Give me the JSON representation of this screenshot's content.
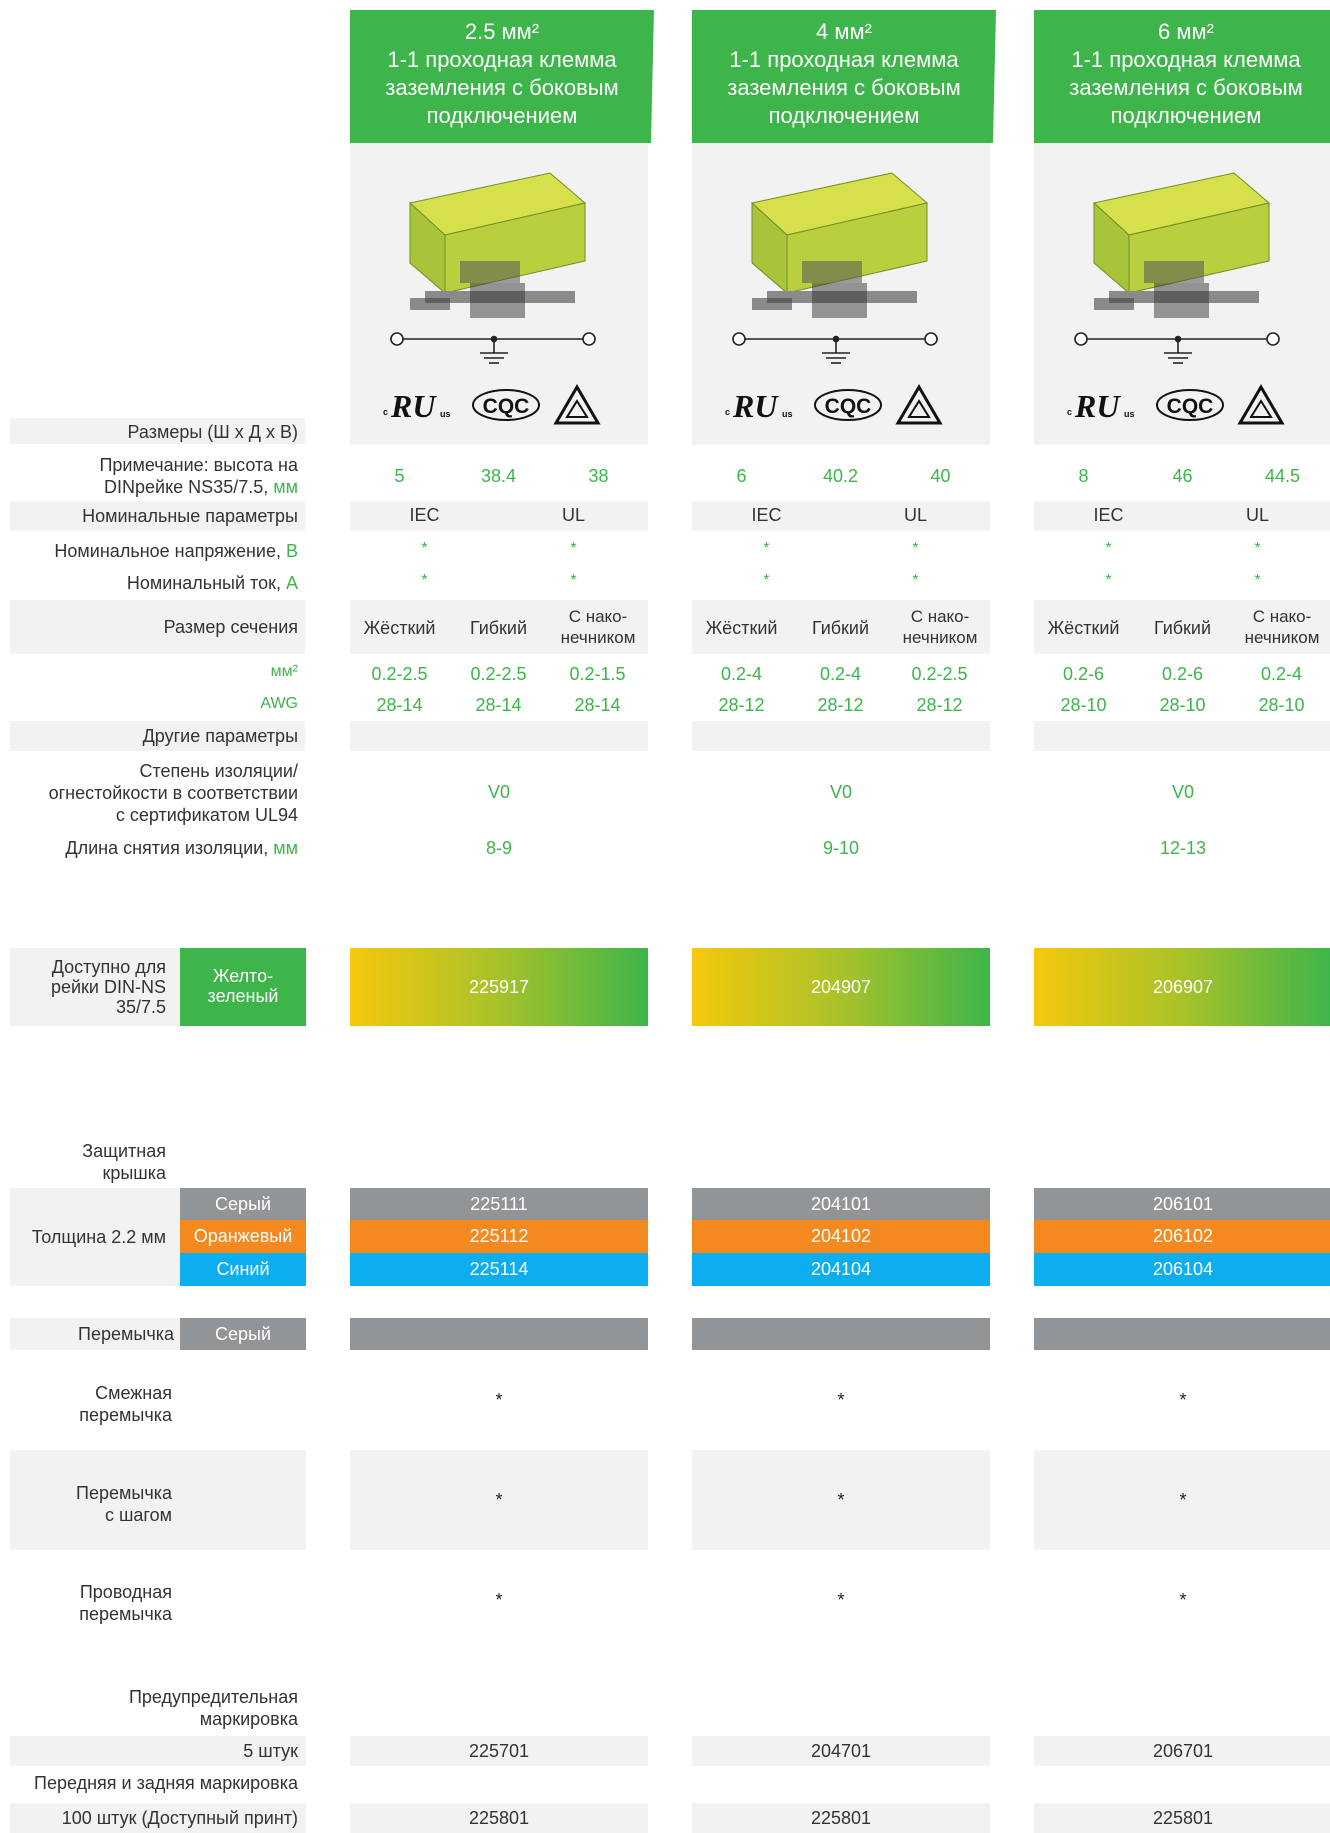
{
  "colors": {
    "green": "#3db54a",
    "grey_bg": "#f2f2f3",
    "cover_grey": "#929598",
    "cover_orange": "#f48a1f",
    "cover_blue": "#0daeef"
  },
  "products": [
    {
      "size": "2.5 мм²",
      "title": [
        "1-1 проходная клемма",
        "заземления с боковым",
        "подключением"
      ],
      "dims": [
        "5",
        "38.4",
        "38"
      ],
      "mm2": [
        "0.2-2.5",
        "0.2-2.5",
        "0.2-1.5"
      ],
      "awg": [
        "28-14",
        "28-14",
        "28-14"
      ],
      "insulation": "V0",
      "strip": "8-9",
      "din_code": "225917",
      "covers": [
        "225111",
        "225112",
        "225114"
      ],
      "adjacent": "*",
      "step": "*",
      "wire": "*",
      "warn5": "225701",
      "marking100": "225801"
    },
    {
      "size": "4 мм²",
      "title": [
        "1-1 проходная клемма",
        "заземления с боковым",
        "подключением"
      ],
      "dims": [
        "6",
        "40.2",
        "40"
      ],
      "mm2": [
        "0.2-4",
        "0.2-4",
        "0.2-2.5"
      ],
      "awg": [
        "28-12",
        "28-12",
        "28-12"
      ],
      "insulation": "V0",
      "strip": "9-10",
      "din_code": "204907",
      "covers": [
        "204101",
        "204102",
        "204104"
      ],
      "adjacent": "*",
      "step": "*",
      "wire": "*",
      "warn5": "204701",
      "marking100": "225801"
    },
    {
      "size": "6 мм²",
      "title": [
        "1-1 проходная клемма",
        "заземления с боковым",
        "подключением"
      ],
      "dims": [
        "8",
        "46",
        "44.5"
      ],
      "mm2": [
        "0.2-6",
        "0.2-6",
        "0.2-4"
      ],
      "awg": [
        "28-10",
        "28-10",
        "28-10"
      ],
      "insulation": "V0",
      "strip": "12-13",
      "din_code": "206907",
      "covers": [
        "206101",
        "206102",
        "206104"
      ],
      "adjacent": "*",
      "step": "*",
      "wire": "*",
      "warn5": "206701",
      "marking100": "225801"
    }
  ],
  "rating_cols": [
    "IEC",
    "UL"
  ],
  "rating_star": "*",
  "section_cols": [
    "Жёсткий",
    "Гибкий",
    "С нако-",
    "нечником"
  ],
  "cert_logos": [
    "ul-logo",
    "cqc-logo",
    "triangle-logo"
  ],
  "labels": {
    "dims": "Размеры (Ш x Д x В)",
    "note_a": "Примечание: высота на",
    "note_b": "DINрейке NS35/7.5,",
    "note_unit": "мм",
    "rated_params": "Номинальные параметры",
    "rated_voltage": "Номинальное напряжение,",
    "rated_voltage_unit": "В",
    "rated_current": "Номинальный ток,",
    "rated_current_unit": "А",
    "section_size": "Размер сечения",
    "mm2": "мм²",
    "awg": "AWG",
    "other": "Другие параметры",
    "ins_a": "Степень изоляции/",
    "ins_b": "огнестойкости в соответствии",
    "ins_c": "с сертификатом UL94",
    "strip": "Длина снятия изоляции,",
    "strip_unit": "мм",
    "avail_a": "Доступно для",
    "avail_b": "рейки DIN-NS",
    "avail_c": "35/7.5",
    "yg_a": "Желто-",
    "yg_b": "зеленый",
    "cover_a": "Защитная",
    "cover_b": "крышка",
    "thickness": "Толщина 2.2 мм",
    "grey": "Серый",
    "orange": "Оранжевый",
    "blue": "Синий",
    "jumper": "Перемычка",
    "jumper_grey": "Серый",
    "adj_a": "Смежная",
    "adj_b": "перемычка",
    "step_a": "Перемычка",
    "step_b": "с шагом",
    "wire_a": "Проводная",
    "wire_b": "перемычка",
    "warn_a": "Предупредительная",
    "warn_b": "маркировка",
    "five": "5 штук",
    "front_back": "Передняя и задняя маркировка",
    "hundred": "100 штук (Доступный принт)"
  }
}
